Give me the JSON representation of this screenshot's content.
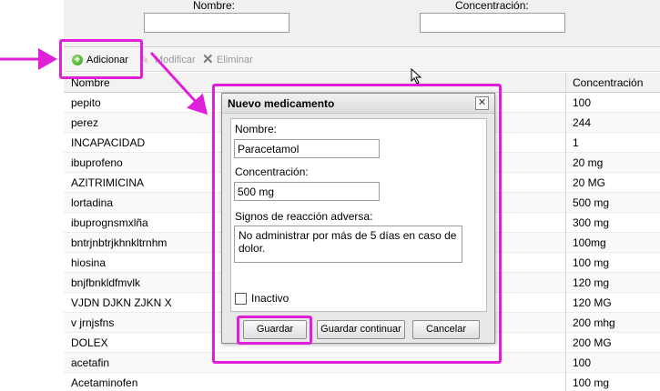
{
  "filters": {
    "name_label": "Nombre:",
    "name_value": "",
    "concentration_label": "Concentración:",
    "concentration_value": ""
  },
  "toolbar": {
    "add_label": "Adicionar",
    "modify_label": "Modificar",
    "delete_label": "Eliminar"
  },
  "grid": {
    "headers": {
      "name": "Nombre",
      "concentration": "Concentración"
    },
    "rows": [
      {
        "name": "pepito",
        "concentration": "100"
      },
      {
        "name": "perez",
        "concentration": "244"
      },
      {
        "name": "INCAPACIDAD",
        "concentration": "1"
      },
      {
        "name": "ibuprofeno",
        "concentration": "20 mg"
      },
      {
        "name": "AZITRIMICINA",
        "concentration": "20 MG"
      },
      {
        "name": "lortadina",
        "concentration": "500 mg"
      },
      {
        "name": "ibuprognsmxlña",
        "concentration": "300 mg"
      },
      {
        "name": "bntrjnbtrjkhnkltrnhm",
        "concentration": "100mg"
      },
      {
        "name": "hiosina",
        "concentration": "100 mg"
      },
      {
        "name": "bnjfbnkldfmvlk",
        "concentration": "120 mg"
      },
      {
        "name": "VJDN DJKN ZJKN X",
        "concentration": "120 MG"
      },
      {
        "name": "v jrnjsfns",
        "concentration": "200 mhg"
      },
      {
        "name": "DOLEX",
        "concentration": "200 MG"
      },
      {
        "name": "acetafin",
        "concentration": "100"
      },
      {
        "name": "Acetaminofen",
        "concentration": "100 mg"
      }
    ]
  },
  "dialog": {
    "title": "Nuevo medicamento",
    "close_glyph": "✕",
    "name_label": "Nombre:",
    "name_value": "Paracetamol",
    "concentration_label": "Concentración:",
    "concentration_value": "500 mg",
    "reactions_label": "Signos de reacción adversa:",
    "reactions_value": "No administrar por más de 5 días en caso de dolor.",
    "inactive_label": "Inactivo",
    "inactive_checked": false,
    "save_label": "Guardar",
    "save_continue_label": "Guardar continuar",
    "cancel_label": "Cancelar"
  },
  "icons": {
    "add": "add-circle-icon",
    "modify": "pencil-icon",
    "delete": "x-icon",
    "cursor": "mouse-pointer-icon"
  },
  "colors": {
    "annotation": "#e020d8",
    "add_icon": "#3a9a1e",
    "disabled_text": "#9a9a9a"
  }
}
